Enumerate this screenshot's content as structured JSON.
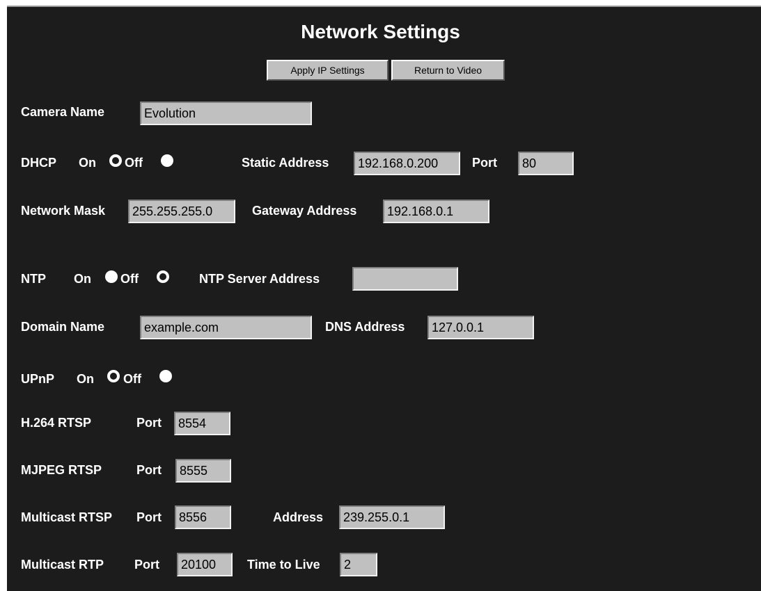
{
  "page": {
    "title": "Network Settings",
    "apply_button": "Apply IP Settings",
    "return_button": "Return to Video"
  },
  "camera_name": {
    "label": "Camera Name",
    "value": "Evolution"
  },
  "dhcp": {
    "label": "DHCP",
    "on_label": "On",
    "off_label": "Off",
    "selected": "on",
    "static_address_label": "Static Address",
    "static_address": "192.168.0.200",
    "port_label": "Port",
    "port": "80"
  },
  "network": {
    "mask_label": "Network Mask",
    "mask": "255.255.255.0",
    "gateway_label": "Gateway Address",
    "gateway": "192.168.0.1"
  },
  "ntp": {
    "label": "NTP",
    "on_label": "On",
    "off_label": "Off",
    "selected": "off",
    "server_label": "NTP Server Address",
    "server": ""
  },
  "domain": {
    "label": "Domain Name",
    "value": "example.com",
    "dns_label": "DNS Address",
    "dns": "127.0.0.1"
  },
  "upnp": {
    "label": "UPnP",
    "on_label": "On",
    "off_label": "Off",
    "selected": "on"
  },
  "h264": {
    "label": "H.264 RTSP",
    "port_label": "Port",
    "port": "8554"
  },
  "mjpeg": {
    "label": "MJPEG RTSP",
    "port_label": "Port",
    "port": "8555"
  },
  "multicast_rtsp": {
    "label": "Multicast RTSP",
    "port_label": "Port",
    "port": "8556",
    "address_label": "Address",
    "address": "239.255.0.1"
  },
  "multicast_rtp": {
    "label": "Multicast RTP",
    "port_label": "Port",
    "port": "20100",
    "ttl_label": "Time to Live",
    "ttl": "2"
  },
  "colors": {
    "background": "#1c1c1c",
    "field": "#c0c0c0",
    "text": "#ffffff"
  }
}
